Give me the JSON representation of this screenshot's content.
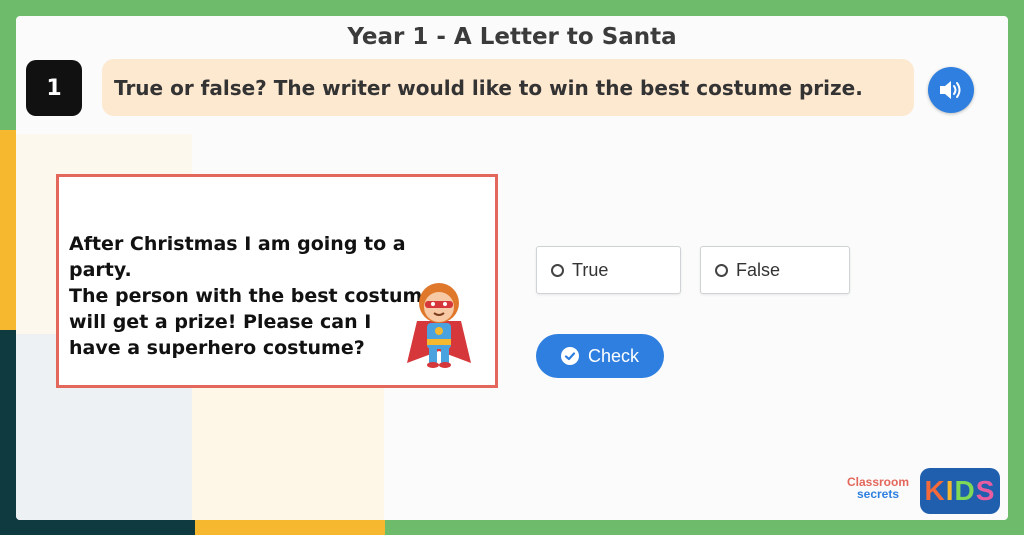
{
  "header": {
    "title": "Year 1 - A Letter to Santa"
  },
  "question": {
    "number": "1",
    "text": "True or false? The writer would like to win the best costume prize."
  },
  "passage": {
    "text": "After Christmas I am going to a party.\nThe person with the best costume\nwill get a prize! Please can I\nhave a superhero costume?"
  },
  "options": [
    {
      "label": "True"
    },
    {
      "label": "False"
    }
  ],
  "actions": {
    "check_label": "Check"
  },
  "branding": {
    "line1": "Classroom",
    "line2": "secrets",
    "kids_k": "K",
    "kids_i": "I",
    "kids_d": "D",
    "kids_s": "S"
  },
  "icons": {
    "audio": "speaker-icon",
    "check": "check-circle-icon",
    "hero": "superhero-boy-illustration"
  },
  "colors": {
    "accent_blue": "#2f7fe0",
    "question_bg": "#fde8d0",
    "passage_border": "#e4675b",
    "background_green": "#6dbb6b"
  }
}
